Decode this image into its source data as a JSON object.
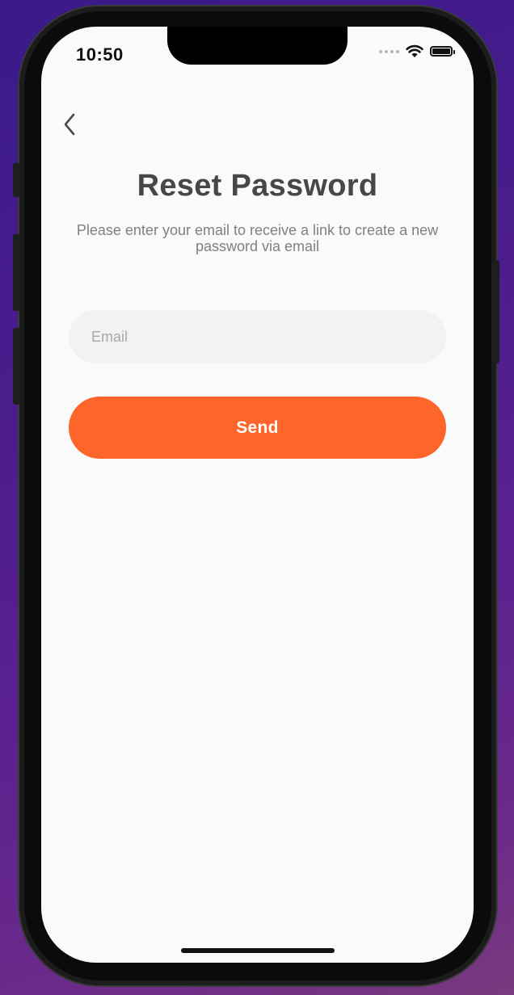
{
  "status_bar": {
    "time": "10:50"
  },
  "icons": {
    "back": "chevron-left-icon",
    "wifi": "wifi-icon",
    "battery": "battery-icon",
    "signal": "cellular-signal-icon"
  },
  "reset": {
    "title": "Reset Password",
    "subtitle": "Please enter your email to receive a link to create a new password via email"
  },
  "form": {
    "email_placeholder": "Email",
    "email_value": "",
    "send_label": "Send"
  },
  "colors": {
    "accent": "#fd652a",
    "title": "#474747",
    "subtitle": "#808080",
    "input_bg": "#f2f2f2",
    "screen_bg": "#fafafa"
  }
}
